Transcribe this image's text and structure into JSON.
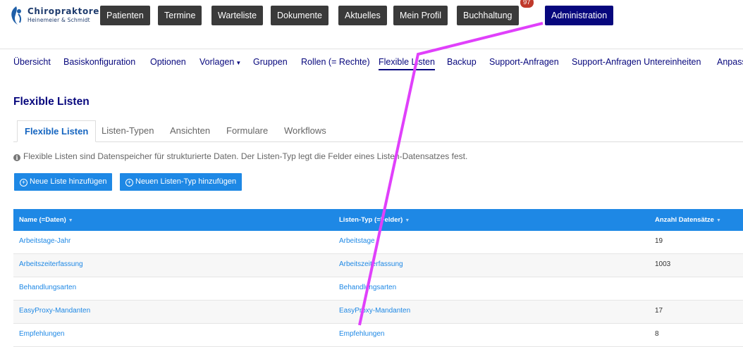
{
  "brand": {
    "title": "Chiropraktoren",
    "subtitle": "Heinemeier & Schmidt"
  },
  "topnav": {
    "items": [
      {
        "label": "Patienten"
      },
      {
        "label": "Termine"
      },
      {
        "label": "Warteliste"
      },
      {
        "label": "Dokumente"
      },
      {
        "label": "Aktuelles"
      },
      {
        "label": "Mein Profil"
      },
      {
        "label": "Buchhaltung"
      },
      {
        "label": "Administration"
      }
    ],
    "badge": "97",
    "active": "Administration"
  },
  "subnav": {
    "items": [
      {
        "label": "Übersicht"
      },
      {
        "label": "Basiskonfiguration"
      },
      {
        "label": "Optionen"
      },
      {
        "label": "Vorlagen"
      },
      {
        "label": "Gruppen"
      },
      {
        "label": "Rollen (= Rechte)"
      },
      {
        "label": "Flexible Listen"
      },
      {
        "label": "Backup"
      },
      {
        "label": "Support-Anfragen"
      },
      {
        "label": "Support-Anfragen Untereinheiten"
      },
      {
        "label": "Anpass"
      }
    ],
    "active": "Flexible Listen"
  },
  "page": {
    "title": "Flexible Listen"
  },
  "tabs": {
    "items": [
      {
        "label": "Flexible Listen"
      },
      {
        "label": "Listen-Typen"
      },
      {
        "label": "Ansichten"
      },
      {
        "label": "Formulare"
      },
      {
        "label": "Workflows"
      }
    ],
    "active": "Flexible Listen"
  },
  "info_text": "Flexible Listen sind Datenspeicher für strukturierte Daten. Der Listen-Typ legt die Felder eines Listen-Datensatzes fest.",
  "actions": {
    "new_list": "Neue Liste hinzufügen",
    "new_list_type": "Neuen Listen-Typ hinzufügen"
  },
  "table": {
    "columns": [
      "Name (=Daten)",
      "Listen-Typ (=Felder)",
      "Anzahl Datensätze"
    ],
    "rows": [
      {
        "name": "Arbeitstage-Jahr",
        "type": "Arbeitstage",
        "count": "19"
      },
      {
        "name": "Arbeitszeiterfassung",
        "type": "Arbeitszeiterfassung",
        "count": "1003"
      },
      {
        "name": "Behandlungsarten",
        "type": "Behandlungsarten",
        "count": ""
      },
      {
        "name": "EasyProxy-Mandanten",
        "type": "EasyProxy-Mandanten",
        "count": "17"
      },
      {
        "name": "Empfehlungen",
        "type": "Empfehlungen",
        "count": "8"
      }
    ]
  },
  "colors": {
    "accent": "#1e88e5",
    "nav_dark": "#3a3a3a",
    "nav_active": "#07077d",
    "annotation": "#e040fb"
  }
}
